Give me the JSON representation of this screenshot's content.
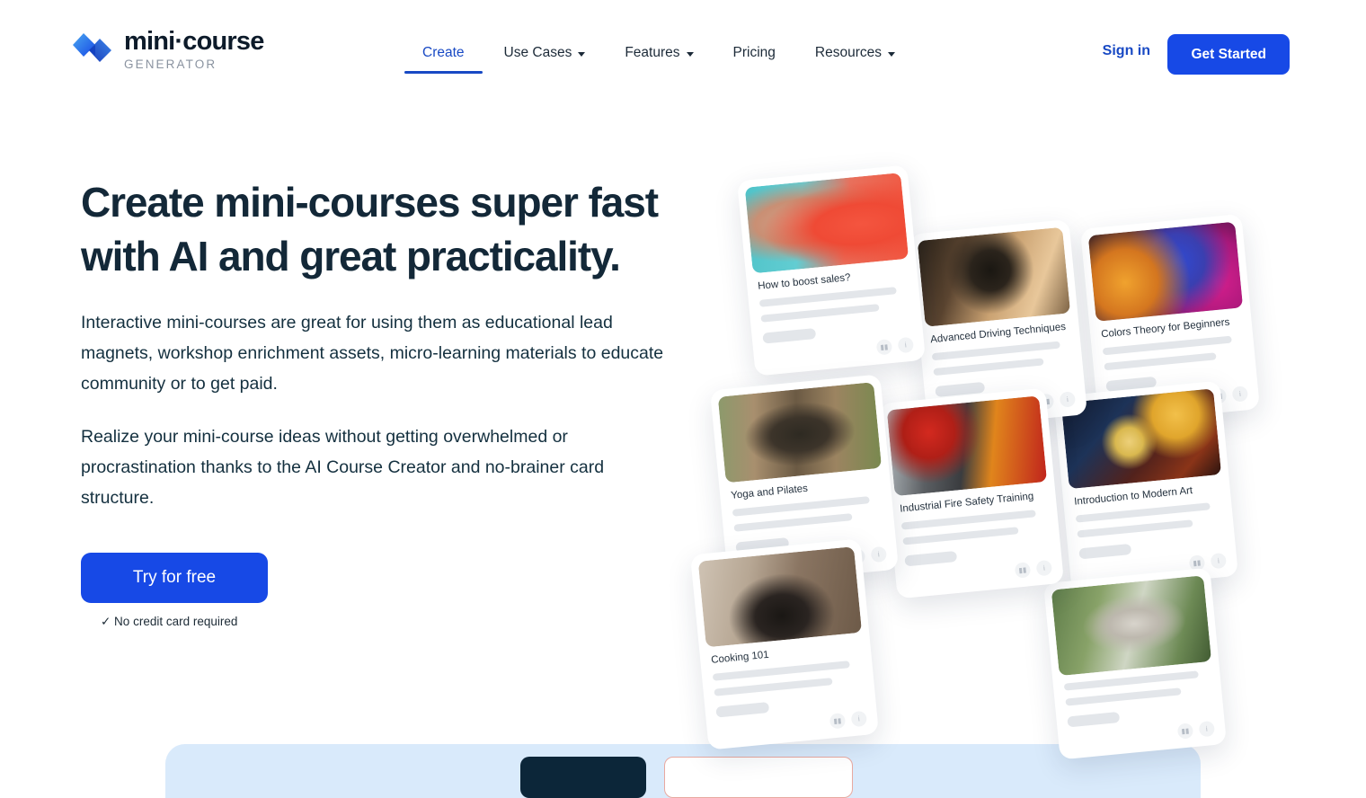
{
  "brand": {
    "logo_icon": "mini-course-logo-mark",
    "title": "mini·course",
    "subtitle": "GENERATOR",
    "accent_blue": "#1749e6",
    "link_blue": "#1849c4",
    "heading_navy": "#132838"
  },
  "nav": {
    "items": [
      {
        "label": "Create",
        "has_dropdown": false,
        "active": true
      },
      {
        "label": "Use Cases",
        "has_dropdown": true,
        "active": false
      },
      {
        "label": "Features",
        "has_dropdown": true,
        "active": false
      },
      {
        "label": "Pricing",
        "has_dropdown": false,
        "active": false
      },
      {
        "label": "Resources",
        "has_dropdown": true,
        "active": false
      }
    ],
    "signin_label": "Sign in",
    "get_started_label": "Get Started"
  },
  "hero": {
    "heading_line1": "Create mini-courses super fast",
    "heading_line2": "with AI and great practicality.",
    "paragraph1": "Interactive mini-courses are great for using them as educational lead magnets, workshop enrichment assets, micro-learning materials to educate community or to get paid.",
    "paragraph2": "Realize your mini-course ideas without getting overwhelmed or procrastination thanks to the AI Course Creator and no-brainer card structure.",
    "cta_label": "Try for free",
    "cta_note": "✓ No credit card required"
  },
  "collage": {
    "cards": [
      {
        "title": "How to boost sales?",
        "image": "woman-with-phone-photo",
        "chart_icon": "bar-chart-icon",
        "info_icon": "info-icon"
      },
      {
        "title": "Advanced Driving Techniques",
        "image": "car-wheel-burnout-photo",
        "chart_icon": "bar-chart-icon",
        "info_icon": "info-icon"
      },
      {
        "title": "Colors Theory for Beginners",
        "image": "color-ink-smoke-photo",
        "chart_icon": "bar-chart-icon",
        "info_icon": "info-icon"
      },
      {
        "title": "Yoga and Pilates",
        "image": "yoga-outdoors-photo",
        "chart_icon": "bar-chart-icon",
        "info_icon": "info-icon"
      },
      {
        "title": "Industrial Fire Safety Training",
        "image": "firefighter-photo",
        "chart_icon": "bar-chart-icon",
        "info_icon": "info-icon"
      },
      {
        "title": "Introduction to Modern Art",
        "image": "starry-night-art-photo",
        "chart_icon": "bar-chart-icon",
        "info_icon": "info-icon"
      },
      {
        "title": "Cooking 101",
        "image": "cooking-pan-photo",
        "chart_icon": "bar-chart-icon",
        "info_icon": "info-icon"
      },
      {
        "title": "",
        "image": "tennis-player-photo",
        "chart_icon": "bar-chart-icon",
        "info_icon": "info-icon"
      }
    ]
  },
  "bottom_panel": {
    "background": "#d9eafb",
    "dark_tab_color": "#0c2639",
    "light_tab_border": "#e8a9a0"
  }
}
